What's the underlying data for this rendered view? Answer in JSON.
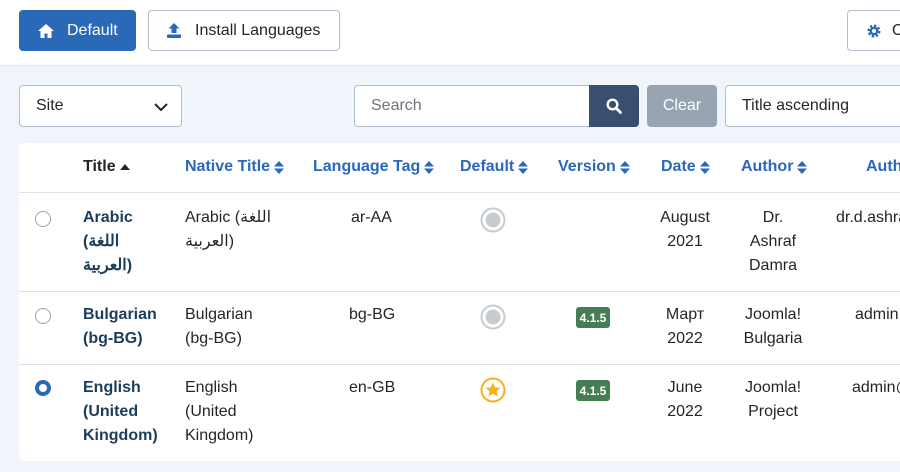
{
  "toolbar": {
    "default_label": "Default",
    "install_label": "Install Languages",
    "options_label": "O"
  },
  "filters": {
    "site_select_value": "Site",
    "search_placeholder": "Search",
    "clear_label": "Clear",
    "sort_value": "Title ascending"
  },
  "table": {
    "columns": [
      "Title",
      "Native Title",
      "Language Tag",
      "Default",
      "Version",
      "Date",
      "Author",
      "Auth"
    ],
    "rows": [
      {
        "title": [
          "Arabic",
          "(اللغة",
          "العربية)"
        ],
        "native": [
          "Arabic (اللغة",
          "العربية)"
        ],
        "tag": "ar-AA",
        "default": "not-default",
        "version": "",
        "date": [
          "August",
          "2021"
        ],
        "author": [
          "Dr.",
          "Ashraf",
          "Damra"
        ],
        "author_email": "dr.d.ashra",
        "selected": false
      },
      {
        "title": [
          "Bulgarian",
          "(bg-BG)"
        ],
        "native": [
          "Bulgarian",
          "(bg-BG)"
        ],
        "tag": "bg-BG",
        "default": "not-default",
        "version": "4.1.5",
        "date": [
          "Март",
          "2022"
        ],
        "author": [
          "Joomla!",
          "Bulgaria"
        ],
        "author_email": "admin",
        "selected": false
      },
      {
        "title": [
          "English",
          "(United",
          "Kingdom)"
        ],
        "native": [
          "English",
          "(United",
          "Kingdom)"
        ],
        "tag": "en-GB",
        "default": "default",
        "version": "4.1.5",
        "date": [
          "June",
          "2022"
        ],
        "author": [
          "Joomla!",
          "Project"
        ],
        "author_email": "admin@",
        "selected": true
      }
    ]
  },
  "colors": {
    "primary": "#2a69b8",
    "search_button": "#384f70",
    "clear_button": "#98a4b1",
    "version_badge": "#457d54",
    "default_star": "#f7b219"
  },
  "icons": {
    "default_button": "home-icon",
    "install_button": "upload-icon",
    "options_button": "gear-icon",
    "search_button": "search-icon",
    "select": "chevron-down-icon"
  }
}
